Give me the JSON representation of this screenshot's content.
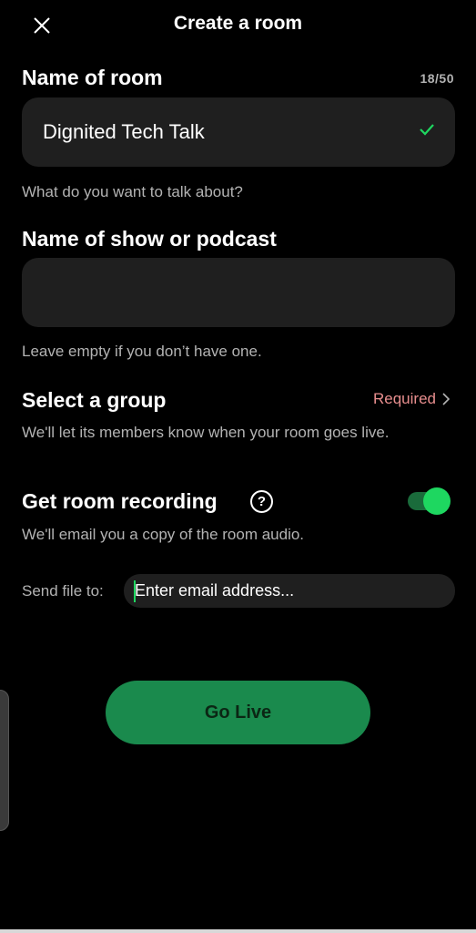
{
  "header": {
    "title": "Create a room",
    "close_icon": "close-icon"
  },
  "room_name": {
    "label": "Name of room",
    "counter": "18/50",
    "value": "Dignited Tech Talk",
    "helper": "What do you want to talk about?",
    "check_color": "#1ed760"
  },
  "show_name": {
    "label": "Name of show or podcast",
    "value": "",
    "helper": "Leave empty if you don’t have one."
  },
  "group": {
    "label": "Select a group",
    "required_text": "Required",
    "helper": "We'll let its members know when your room goes live."
  },
  "recording": {
    "label": "Get room recording",
    "help_icon_text": "?",
    "enabled": true,
    "helper": "We'll email you a copy of the room audio."
  },
  "send_file": {
    "label": "Send file to:",
    "placeholder": "Enter email address..."
  },
  "actions": {
    "go_live_label": "Go Live"
  },
  "colors": {
    "background": "#000000",
    "field": "#1f1f1f",
    "accent": "#1ed760",
    "button": "#1a8a4d",
    "required": "#e88e8e"
  }
}
